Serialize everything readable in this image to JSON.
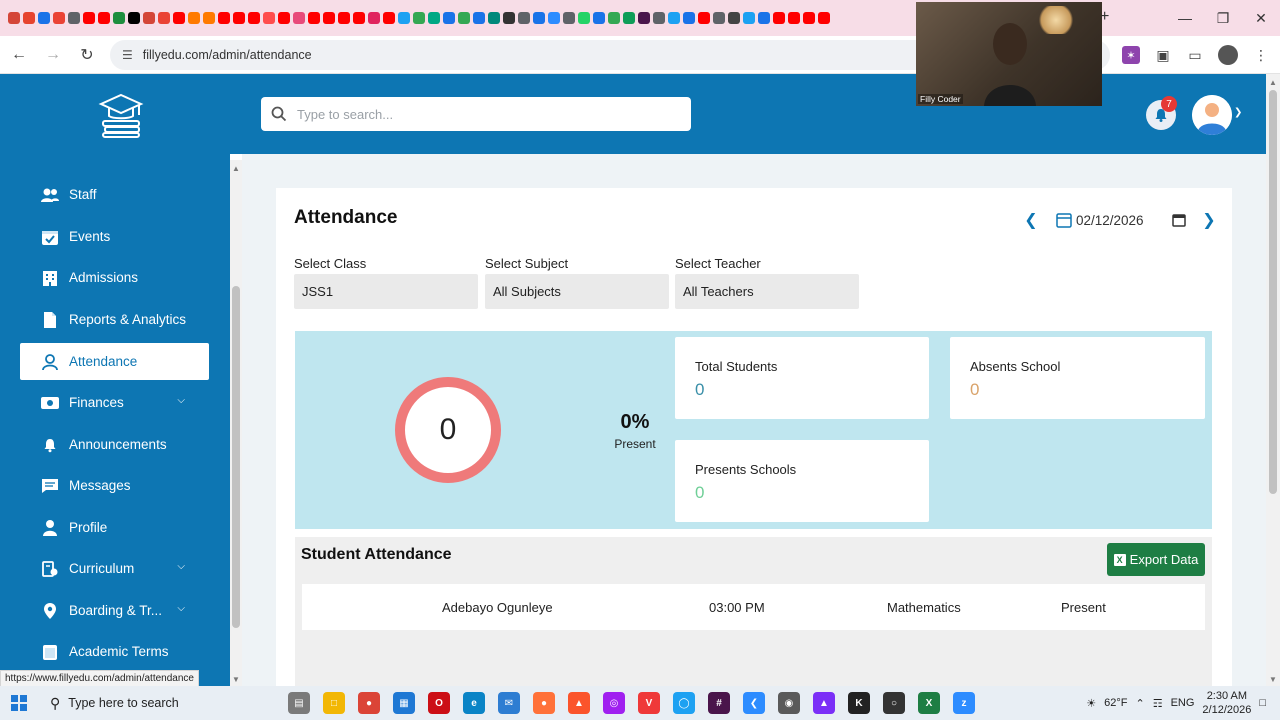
{
  "browser": {
    "url": "fillyedu.com/admin/attendance",
    "status_url": "https://www.fillyedu.com/admin/attendance",
    "tab_icon_colors": [
      "#d44638",
      "#e6442f",
      "#1a73e8",
      "#ea4335",
      "#5f6368",
      "#ff0000",
      "#ff0000",
      "#1e8e3e",
      "#000000",
      "#d44638",
      "#ea4335",
      "#ff0000",
      "#ff7a00",
      "#ff7a00",
      "#ff0000",
      "#ff0000",
      "#ff0000",
      "#ff4d4d",
      "#ff0000",
      "#e84a7a",
      "#ff0000",
      "#ff0000",
      "#ff0000",
      "#ff0000",
      "#e0245e",
      "#ff0000",
      "#1da1f2",
      "#34a853",
      "#00a884",
      "#1a73e8",
      "#34a853",
      "#1a73e8",
      "#00897b",
      "#333333",
      "#5f6368",
      "#1a73e8",
      "#2d8cff",
      "#5f6368",
      "#25d366",
      "#1a73e8",
      "#34a853",
      "#0f9d58",
      "#4a154b",
      "#5f6368",
      "#1da1f2",
      "#1a73e8",
      "#ff0000",
      "#5f6368",
      "#444444",
      "#1da1f2",
      "#1a73e8",
      "#ff0000",
      "#ff0000",
      "#ff0000",
      "#ff0000"
    ]
  },
  "webcam": {
    "name": "Filly Coder"
  },
  "header": {
    "search_placeholder": "Type to search...",
    "notification_count": "7"
  },
  "sidebar": {
    "items": [
      {
        "label": "Staff",
        "icon": "staff-icon"
      },
      {
        "label": "Events",
        "icon": "calendar-check-icon"
      },
      {
        "label": "Admissions",
        "icon": "building-icon"
      },
      {
        "label": "Reports & Analytics",
        "icon": "document-icon"
      },
      {
        "label": "Attendance",
        "icon": "user-icon",
        "active": true
      },
      {
        "label": "Finances",
        "icon": "money-icon",
        "chevron": true
      },
      {
        "label": "Announcements",
        "icon": "bell-icon"
      },
      {
        "label": "Messages",
        "icon": "message-icon"
      },
      {
        "label": "Profile",
        "icon": "profile-icon"
      },
      {
        "label": "Curriculum",
        "icon": "curriculum-icon",
        "chevron": true
      },
      {
        "label": "Boarding & Tr...",
        "icon": "location-icon",
        "chevron": true
      },
      {
        "label": "Academic Terms",
        "icon": "terms-icon"
      }
    ]
  },
  "attendance": {
    "title": "Attendance",
    "date": "02/12/2026",
    "filters": {
      "class_label": "Select Class",
      "class_value": "JSS1",
      "subject_label": "Select Subject",
      "subject_value": "All Subjects",
      "teacher_label": "Select Teacher",
      "teacher_value": "All Teachers"
    },
    "ring_value": "0",
    "percent": "0%",
    "percent_label": "Present",
    "stats": {
      "total_students_label": "Total Students",
      "total_students_value": "0",
      "absents_label": "Absents School",
      "absents_value": "0",
      "presents_label": "Presents Schools",
      "presents_value": "0"
    },
    "colors": {
      "primary": "#0d76b3",
      "ring": "#ef7a7a",
      "total_value": "#3a8fa8",
      "absent_value": "#d9a36a",
      "present_value": "#6fcf97",
      "export": "#1e7e44"
    }
  },
  "student_attendance": {
    "title": "Student Attendance",
    "export_label": "Export Data",
    "rows": [
      {
        "name": "Adebayo Ogunleye",
        "time": "03:00 PM",
        "subject": "Mathematics",
        "status": "Present"
      }
    ]
  },
  "taskbar": {
    "search_placeholder": "Type here to search",
    "temperature": "62°F",
    "language": "ENG",
    "time": "2:30 AM",
    "date": "2/12/2026"
  }
}
